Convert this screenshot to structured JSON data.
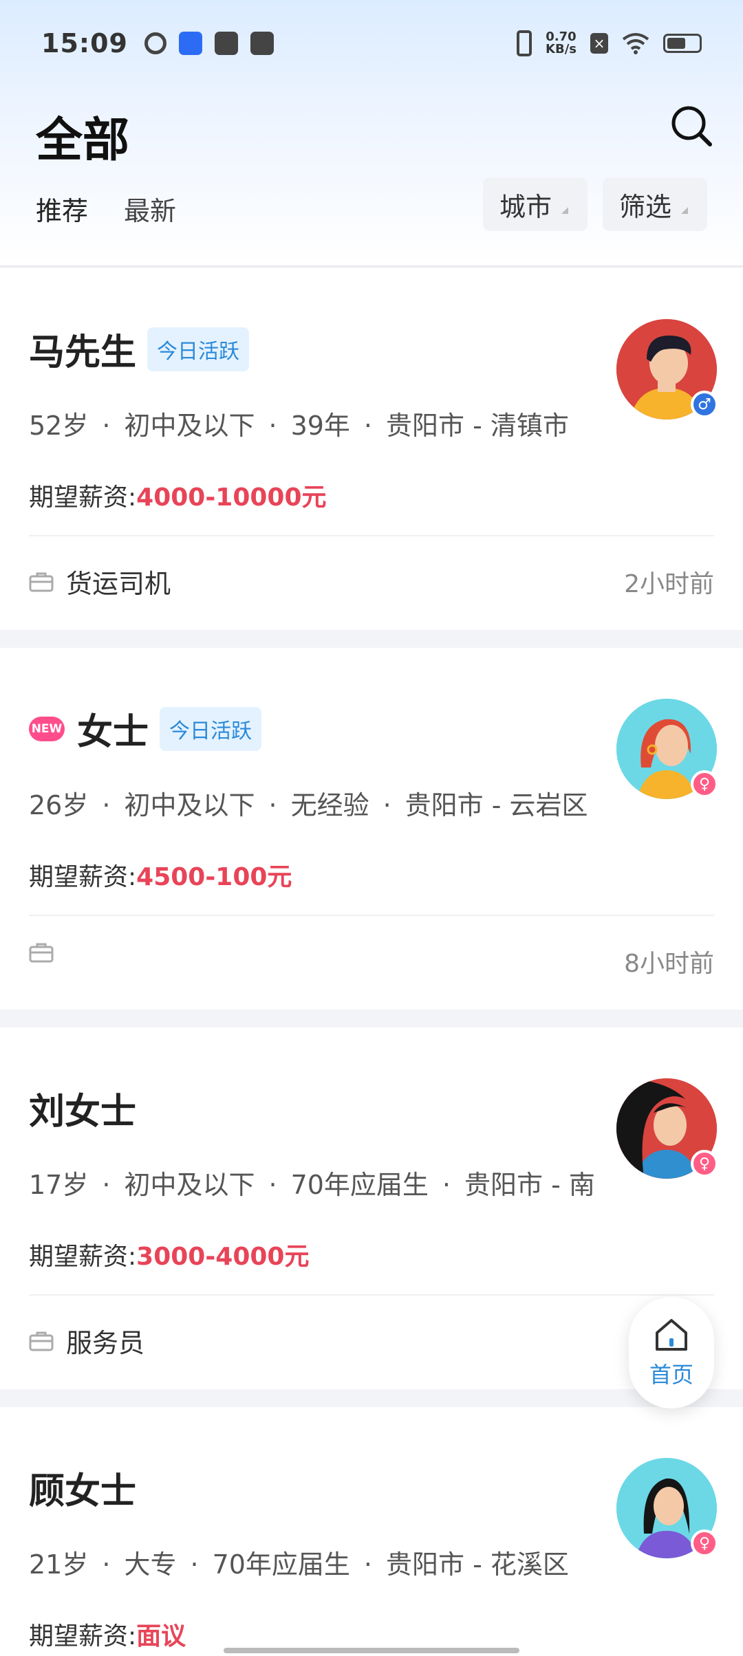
{
  "status_bar": {
    "time": "15:09",
    "net_speed": "0.70",
    "net_unit": "KB/s"
  },
  "header": {
    "title": "全部",
    "tabs": [
      {
        "label": "推荐",
        "active": true
      },
      {
        "label": "最新",
        "active": false
      }
    ],
    "filters": [
      {
        "label": "城市"
      },
      {
        "label": "筛选"
      }
    ]
  },
  "candidates": [
    {
      "name": "马先生",
      "is_new": false,
      "active_tag": "今日活跃",
      "age": "52岁",
      "education": "初中及以下",
      "experience": "39年",
      "location": "贵阳市 - 清镇市",
      "salary_label": "期望薪资:",
      "salary": "4000-10000元",
      "job": "货运司机",
      "time_ago": "2小时前",
      "gender": "male",
      "avatar_bg": "#d9443f"
    },
    {
      "name": "女士",
      "is_new": true,
      "new_label": "NEW",
      "active_tag": "今日活跃",
      "age": "26岁",
      "education": "初中及以下",
      "experience": "无经验",
      "location": "贵阳市 - 云岩区",
      "salary_label": "期望薪资:",
      "salary": "4500-100元",
      "job": "",
      "time_ago": "8小时前",
      "gender": "female",
      "avatar_bg": "#6cd8e6"
    },
    {
      "name": "刘女士",
      "is_new": false,
      "active_tag": "",
      "age": "17岁",
      "education": "初中及以下",
      "experience": "70年应届生",
      "location": "贵阳市 - 南",
      "salary_label": "期望薪资:",
      "salary": "3000-4000元",
      "job": "服务员",
      "time_ago": "",
      "gender": "female",
      "avatar_bg": "#d9443f"
    },
    {
      "name": "顾女士",
      "is_new": false,
      "active_tag": "",
      "age": "21岁",
      "education": "大专",
      "experience": "70年应届生",
      "location": "贵阳市 - 花溪区",
      "salary_label": "期望薪资:",
      "salary": "面议",
      "job": "",
      "time_ago": "",
      "gender": "female",
      "avatar_bg": "#6cd8e6"
    }
  ],
  "fab": {
    "label": "首页"
  },
  "colors": {
    "accent": "#2b8ad9",
    "salary": "#e84458",
    "male": "#2f74e0",
    "female": "#ff5d86"
  }
}
